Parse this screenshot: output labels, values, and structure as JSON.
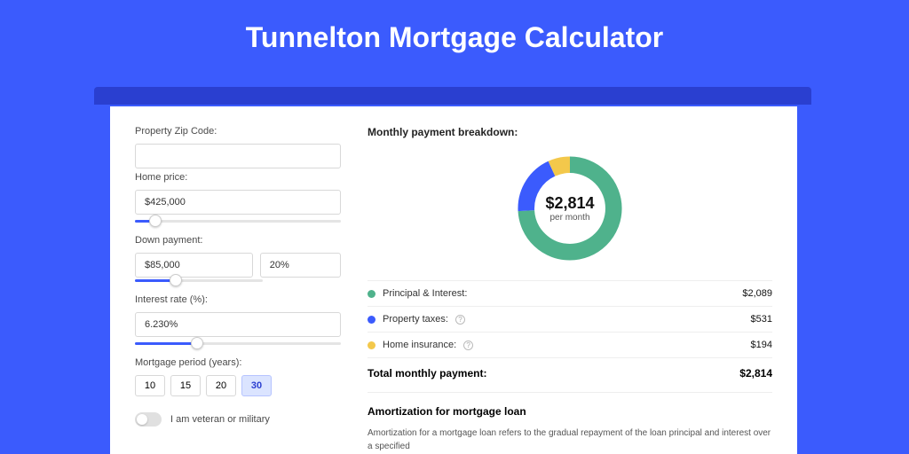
{
  "title": "Tunnelton Mortgage Calculator",
  "form": {
    "zip_label": "Property Zip Code:",
    "zip_value": "",
    "home_price_label": "Home price:",
    "home_price_value": "$425,000",
    "down_payment_label": "Down payment:",
    "down_payment_value": "$85,000",
    "down_payment_pct": "20%",
    "rate_label": "Interest rate (%):",
    "rate_value": "6.230%",
    "period_label": "Mortgage period (years):",
    "periods": [
      "10",
      "15",
      "20",
      "30"
    ],
    "period_selected": "30",
    "veteran_label": "I am veteran or military"
  },
  "breakdown": {
    "title": "Monthly payment breakdown:",
    "center_value": "$2,814",
    "center_sub": "per month",
    "items": [
      {
        "label": "Principal & Interest:",
        "value": "$2,089",
        "color": "g",
        "pct": 74,
        "info": false
      },
      {
        "label": "Property taxes:",
        "value": "$531",
        "color": "b",
        "pct": 19,
        "info": true
      },
      {
        "label": "Home insurance:",
        "value": "$194",
        "color": "y",
        "pct": 7,
        "info": true
      }
    ],
    "total_label": "Total monthly payment:",
    "total_value": "$2,814"
  },
  "amort": {
    "title": "Amortization for mortgage loan",
    "text": "Amortization for a mortgage loan refers to the gradual repayment of the loan principal and interest over a specified"
  },
  "chart_data": {
    "type": "pie",
    "title": "Monthly payment breakdown",
    "values": [
      2089,
      531,
      194
    ],
    "categories": [
      "Principal & Interest",
      "Property taxes",
      "Home insurance"
    ],
    "colors": [
      "#4fb28c",
      "#3b5bfd",
      "#f3c84b"
    ],
    "total": 2814
  }
}
